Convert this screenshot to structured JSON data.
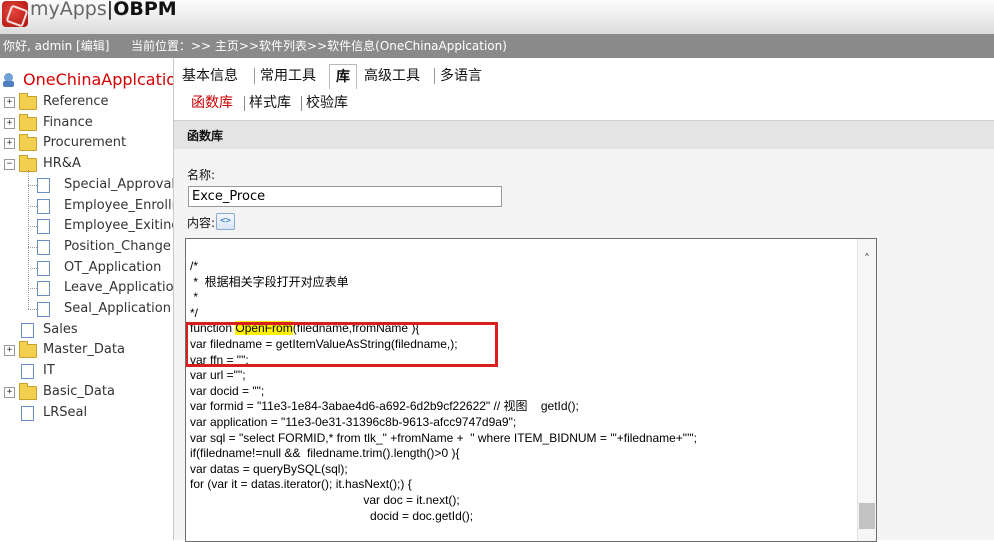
{
  "header": {
    "logo_app": "myApps",
    "logo_sep": "|",
    "logo_brand": "OBPM"
  },
  "infobar": {
    "greeting": "你好, admin [编辑]",
    "breadcrumb": "当前位置：>> 主页>>软件列表>>软件信息(OneChinaApplcation)"
  },
  "sidebar": {
    "root": "OneChinaApplcation",
    "items": [
      {
        "label": "Reference",
        "kind": "folder",
        "toggle": "+"
      },
      {
        "label": "Finance",
        "kind": "folder",
        "toggle": "+"
      },
      {
        "label": "Procurement",
        "kind": "folder",
        "toggle": "+"
      },
      {
        "label": "HR&A",
        "kind": "folder-open",
        "toggle": "−"
      },
      {
        "label": "Special_Approval",
        "kind": "doc"
      },
      {
        "label": "Employee_Enrollm",
        "kind": "doc"
      },
      {
        "label": "Employee_Exiting",
        "kind": "doc"
      },
      {
        "label": "Position_Change",
        "kind": "doc"
      },
      {
        "label": "OT_Application",
        "kind": "doc"
      },
      {
        "label": "Leave_Application",
        "kind": "doc"
      },
      {
        "label": "Seal_Application",
        "kind": "doc"
      },
      {
        "label": "Sales",
        "kind": "doc-top"
      },
      {
        "label": "Master_Data",
        "kind": "folder",
        "toggle": "+"
      },
      {
        "label": "IT",
        "kind": "doc-top"
      },
      {
        "label": "Basic_Data",
        "kind": "folder",
        "toggle": "+"
      },
      {
        "label": "LRSeal",
        "kind": "doc-top"
      }
    ]
  },
  "tabs": [
    {
      "label": "基本信息",
      "active": false
    },
    {
      "label": "常用工具",
      "active": false
    },
    {
      "label": "库",
      "active": true
    },
    {
      "label": "高级工具",
      "active": false
    },
    {
      "label": "多语言",
      "active": false
    }
  ],
  "subtabs": [
    {
      "label": "函数库",
      "active": true
    },
    {
      "label": "样式库",
      "active": false
    },
    {
      "label": "校验库",
      "active": false
    }
  ],
  "section": {
    "title": "函数库"
  },
  "form": {
    "name_label": "名称:",
    "name_value": "Exce_Proce",
    "content_label": "内容:",
    "editor_icon": "editor-toggle-icon"
  },
  "code": {
    "lines": [
      "/*",
      " *  根据相关字段打开对应表单",
      " *",
      "*/",
      "function ",
      "var filedname = getItemValueAsString(filedname,);",
      "var ffn = \"\";",
      "var url =\"\";",
      "var docid = \"\";",
      "var formid = \"11e3-1e84-3abae4d6-a692-6d2b9cf22622\" // 视图    getId();",
      "var application = \"11e3-0e31-31396c8b-9613-afcc9747d9a9\";",
      "var sql = \"select FORMID,* from tlk_\" +fromName +  \" where ITEM_BIDNUM = '\"+filedname+\"'\";",
      "if(filedname!=null &&  filedname.trim().length()>0 ){",
      "var datas = queryBySQL(sql);",
      "for (var it = datas.iterator(); it.hasNext();) {",
      "                                                    var doc = it.next();",
      "                                                      docid = doc.getId();"
    ],
    "function_name": "OpenFrom",
    "function_args": "(filedname,fromName ){"
  },
  "colors": {
    "infobar_bg": "#8a8a8a",
    "root_label": "#d60000",
    "active_subtab": "#cc0000",
    "highlight": "#fff200",
    "callout_border": "#d91e1e"
  }
}
